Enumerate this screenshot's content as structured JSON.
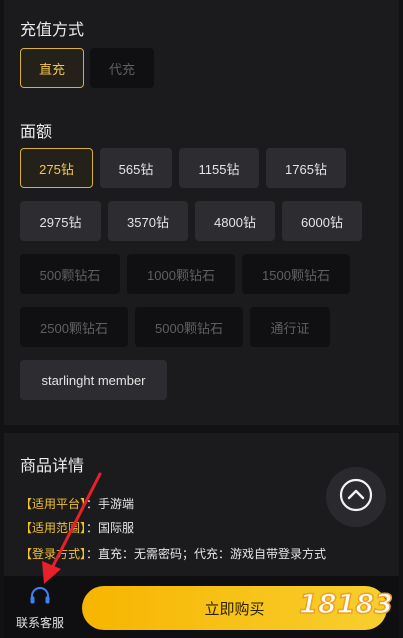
{
  "recharge": {
    "title": "充值方式",
    "options": [
      {
        "label": "直充",
        "state": "selected"
      },
      {
        "label": "代充",
        "state": "disabled"
      }
    ]
  },
  "denomination": {
    "title": "面额",
    "options": [
      {
        "label": "275钻",
        "state": "selected"
      },
      {
        "label": "565钻",
        "state": "normal"
      },
      {
        "label": "1155钻",
        "state": "normal"
      },
      {
        "label": "1765钻",
        "state": "normal"
      },
      {
        "label": "2975钻",
        "state": "normal"
      },
      {
        "label": "3570钻",
        "state": "normal"
      },
      {
        "label": "4800钻",
        "state": "normal"
      },
      {
        "label": "6000钻",
        "state": "normal"
      },
      {
        "label": "500颗钻石",
        "state": "disabled"
      },
      {
        "label": "1000颗钻石",
        "state": "disabled"
      },
      {
        "label": "1500颗钻石",
        "state": "disabled"
      },
      {
        "label": "2500颗钻石",
        "state": "disabled"
      },
      {
        "label": "5000颗钻石",
        "state": "disabled"
      },
      {
        "label": "通行证",
        "state": "disabled"
      },
      {
        "label": "starlinght member",
        "state": "normal"
      }
    ]
  },
  "details": {
    "title": "商品详情",
    "rows": [
      {
        "key": "【适用平台】",
        "sep": "：",
        "value": "手游端"
      },
      {
        "key": "【适用范围】",
        "sep": "：",
        "value": "国际服"
      },
      {
        "key": "【登录方式】",
        "sep": "：",
        "value": "直充：无需密码；代充：游戏自带登录方式"
      }
    ]
  },
  "bottom": {
    "service_label": "联系客服",
    "buy_label": "立即购买",
    "watermark": "18183"
  },
  "colors": {
    "accent": "#f1c232",
    "background": "#121214",
    "panel": "#1b1b1e",
    "annotation": "#e8202a"
  },
  "icons": [
    "chevron-up-icon",
    "headset-icon",
    "annotation-arrow"
  ]
}
